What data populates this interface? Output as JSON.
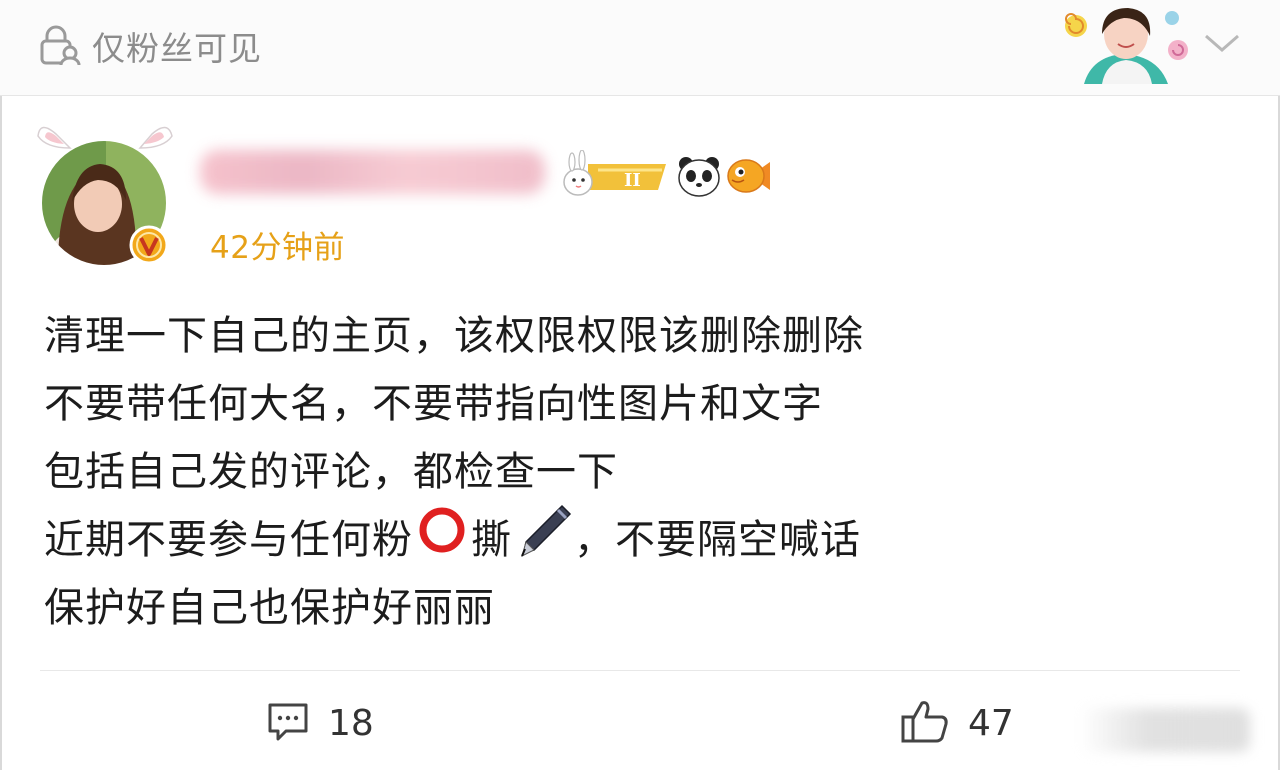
{
  "header": {
    "visibility_label": "仅粉丝可见",
    "visibility_icon": "lock-user-icon",
    "menu_icon": "chevron-down-icon"
  },
  "post": {
    "timestamp": "42分钟前",
    "verified_icon": "verified-v-badge-icon",
    "badges": [
      "rabbit-level-badge-icon",
      "panda-badge-icon",
      "fish-badge-icon"
    ],
    "level_badge_text": "II",
    "lines": [
      [
        "清理一下自己的主页，该权限权限该删除删除"
      ],
      [
        "不要带任何大名，不要带指向性图片和文字"
      ],
      [
        "包括自己发的评论，都检查一下"
      ],
      [
        "近期不要参与任何粉",
        "撕",
        "，不要隔空喊话"
      ],
      [
        "保护好自己也保护好丽丽"
      ]
    ],
    "inline_emoji": [
      "red-circle-emoji-icon",
      "pen-emoji-icon"
    ]
  },
  "actions": {
    "comment_icon": "comment-icon",
    "comment_count": "18",
    "like_icon": "thumbs-up-icon",
    "like_count": "47"
  },
  "colors": {
    "timestamp": "#e6a118",
    "verified_badge": "#f2a81a",
    "muted_text": "#8c8c8c",
    "emoji_circle": "#e02020"
  }
}
